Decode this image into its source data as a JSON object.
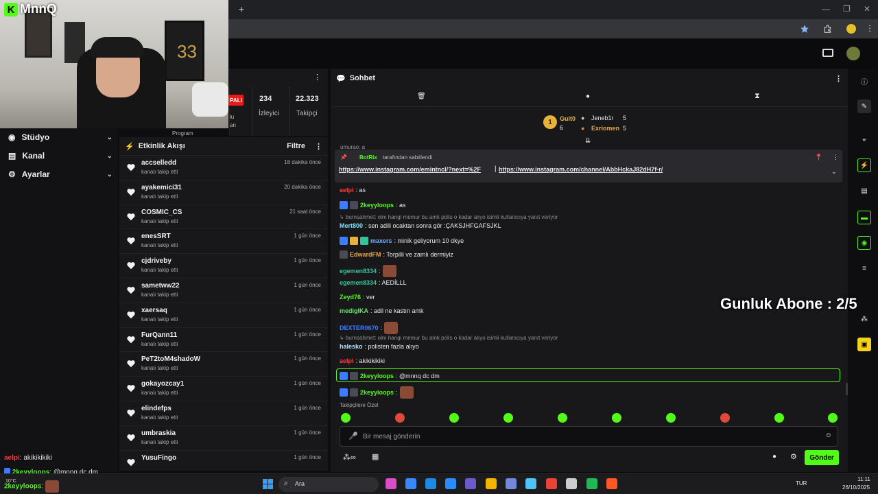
{
  "stream_overlay": {
    "logo": "MnnQ",
    "sub_goal": "Gunluk Abone : 2/5",
    "alerts": [
      {
        "user": "aelpi",
        "text": ": akikikikiki"
      },
      {
        "user": "2keyyloops",
        "text": ": @mnnq dc dm"
      },
      {
        "user": "2keyyloops",
        "text": ":"
      }
    ],
    "weather": "10°C"
  },
  "browser": {
    "new_tab": "+",
    "minimize": "—",
    "restore": "❐",
    "close": "✕"
  },
  "sidebar": {
    "items": [
      {
        "label": "Stüdyo",
        "icon": "studio-icon"
      },
      {
        "label": "Kanal",
        "icon": "channel-icon"
      },
      {
        "label": "Ayarlar",
        "icon": "gear-icon"
      }
    ]
  },
  "stats": {
    "live_badge": "PALI",
    "viewers": {
      "value": "234",
      "label": "İzleyici"
    },
    "followers": {
      "value": "22.323",
      "label": "Takipçi"
    },
    "partial1": "lu",
    "partial2": "an",
    "partial3": "Program"
  },
  "activity": {
    "title": "Etkinlik Akışı",
    "filter": "Filtre",
    "rows": [
      {
        "name": "accselledd",
        "sub": "kanalı takip etti",
        "time": "18 dakika önce"
      },
      {
        "name": "ayakemici31",
        "sub": "kanalı takip etti",
        "time": "20 dakika önce"
      },
      {
        "name": "COSMIC_CS",
        "sub": "kanalı takip etti",
        "time": "21 saat önce"
      },
      {
        "name": "enesSRT",
        "sub": "kanalı takip etti",
        "time": "1 gün önce"
      },
      {
        "name": "cjdriveby",
        "sub": "kanalı takip etti",
        "time": "1 gün önce"
      },
      {
        "name": "sametww22",
        "sub": "kanalı takip etti",
        "time": "1 gün önce"
      },
      {
        "name": "xaersaq",
        "sub": "kanalı takip etti",
        "time": "1 gün önce"
      },
      {
        "name": "FurQann11",
        "sub": "kanalı takip etti",
        "time": "1 gün önce"
      },
      {
        "name": "PeT2toM4shadoW",
        "sub": "kanalı takip etti",
        "time": "1 gün önce"
      },
      {
        "name": "gokayozcay1",
        "sub": "kanalı takip etti",
        "time": "1 gün önce"
      },
      {
        "name": "elindefps",
        "sub": "kanalı takip etti",
        "time": "1 gün önce"
      },
      {
        "name": "umbraskia",
        "sub": "kanalı takip etti",
        "time": "1 gün önce"
      },
      {
        "name": "YusuFingo",
        "sub": "",
        "time": "1 gün önce"
      }
    ]
  },
  "chat": {
    "title": "Sohbet",
    "leaderboard": {
      "first": {
        "name": "Guit0",
        "count": "6"
      },
      "second": {
        "name": "Jeneb1r",
        "count": "5"
      },
      "third": {
        "name": "Exriomen",
        "count": "5"
      }
    },
    "pinned": {
      "author": "BotRix",
      "meta": "tarafından sabitlendi",
      "link1": "https://www.instagram.com/emintncl/?next=%2F",
      "link2": "https://www.instagram.com/channel/AbbHckaJ82dH7f-r/",
      "peek": "umurao: a"
    },
    "messages": [
      {
        "user": "aelpi",
        "text": ": as",
        "color": "#ff3b3b"
      },
      {
        "user": "2keyyloops",
        "text": ": as",
        "color": "#53fc18"
      },
      {
        "reply": "burnsahmet: olm hangi memur bu amk polis o kadar alıyo isimli kullanıcıya yanıt veriyor"
      },
      {
        "user": "Mert800",
        "text": ": sen adili ocaktan sonra gör :ÇAKSJHFGAFSJKL",
        "color": "#7fe0ff"
      },
      {
        "user": "maxers",
        "text": ": minik geliyorum 10 dkye",
        "color": "#6ab0ff"
      },
      {
        "user": "EdwardFM",
        "text": ": Torpilli ve zamlı dermiyiz",
        "color": "#e6a43b"
      },
      {
        "user": "egemen8334",
        "text": ":",
        "color": "#33c49b"
      },
      {
        "user": "egemen8334",
        "text": ": AEDİLLL",
        "color": "#33c49b"
      },
      {
        "user": "Zeyd76",
        "text": ": ver",
        "color": "#53fc18"
      },
      {
        "user": "medigIKA",
        "text": ": adil ne kastın amk",
        "color": "#6ae06a"
      },
      {
        "user": "DEXTER0670",
        "text": ":",
        "color": "#3d7bff"
      },
      {
        "reply": "burnsahmet: olm hangi memur bu amk polis o kadar alıyo isimli kullanıcıya yanıt veriyor"
      },
      {
        "user": "halesko",
        "text": ": polisten fazla alıyo",
        "color": "#b6e3ff"
      },
      {
        "user": "aelpi",
        "text": ": akikikikiki",
        "color": "#ff3b3b"
      },
      {
        "user": "2keyyloops",
        "text": ": @mnnq dc dm",
        "color": "#53fc18"
      },
      {
        "user": "2keyyloops",
        "text": ":",
        "color": "#53fc18"
      }
    ],
    "emote_section": "Takipçilere Özel",
    "input_placeholder": "Bir mesaj gönderin",
    "send": "Gönder"
  },
  "taskbar": {
    "search": "Ara",
    "lang": "TUR",
    "time": "11:11",
    "date": "26/10/2025"
  },
  "colors": {
    "accent": "#53fc18",
    "bg": "#18181b",
    "live": "#e91916"
  }
}
